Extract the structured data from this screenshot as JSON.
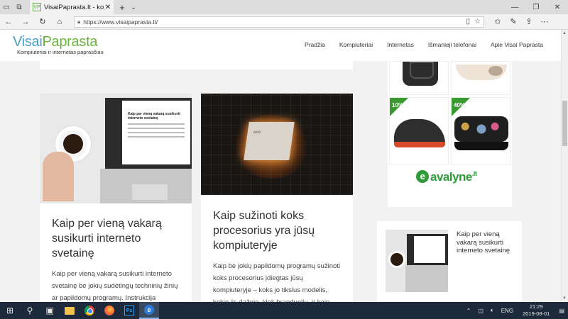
{
  "browser": {
    "tab_title": "VisaiPaprasta.lt - kompi",
    "url": "https://www.visaipaprasta.lt/",
    "icons": [
      "tab-actions-icon",
      "tab-overview-icon",
      "close-icon",
      "new-tab-icon",
      "chevron-down-icon",
      "minimize-icon",
      "maximize-icon",
      "window-close-icon",
      "back-icon",
      "forward-icon",
      "refresh-icon",
      "home-icon",
      "lock-icon",
      "reading-view-icon",
      "favorite-star-icon",
      "favorites-icon",
      "pen-icon",
      "share-icon",
      "more-icon"
    ]
  },
  "site": {
    "logo_part1": "Visai",
    "logo_part2": "Paprasta",
    "tagline": "Kompiuteriai ir internetas paprasčiau",
    "nav": [
      "Pradžia",
      "Kompiuteriai",
      "Internetas",
      "Išmanieji telefonai",
      "Apie Visai Paprasta"
    ],
    "colors": {
      "logo_blue": "#4a9fc8",
      "logo_green": "#6cb33e",
      "badge_green": "#3a9a2f"
    }
  },
  "posts": [
    {
      "title": "Kaip per vieną vakarą susikurti interneto svetainę",
      "excerpt": "Kaip per vieną vakarą susikurti interneto svetainę be jokių sudėtingų techninių žinių ar papildomų programų. Instrukcija",
      "image_doc_title": "Kaip per vieną vakarą susikurti interneto svetainę"
    },
    {
      "title": "Kaip sužinoti koks procesorius yra jūsų kompiuteryje",
      "excerpt": "Kaip be jokių papildomų programų sužinoti koks procesorius įdiegtas jūsų kompiuteryje – koks jo tikslus modelis, kokio jis dažnio, kiek branduolių, ir kaip",
      "image_chip_label": "AMD"
    }
  ],
  "ad": {
    "discount1": "10%",
    "discount2": "40%",
    "brand": "avalyne",
    "brand_mark": "e",
    "brand_tld": ".lt"
  },
  "widget": {
    "title": "Kaip per vieną vakarą susikurti interneto svetainę"
  },
  "taskbar": {
    "ps_label": "Ps",
    "edge_label": "e",
    "lang": "ENG",
    "time": "21:29",
    "date": "2019-08-01"
  }
}
